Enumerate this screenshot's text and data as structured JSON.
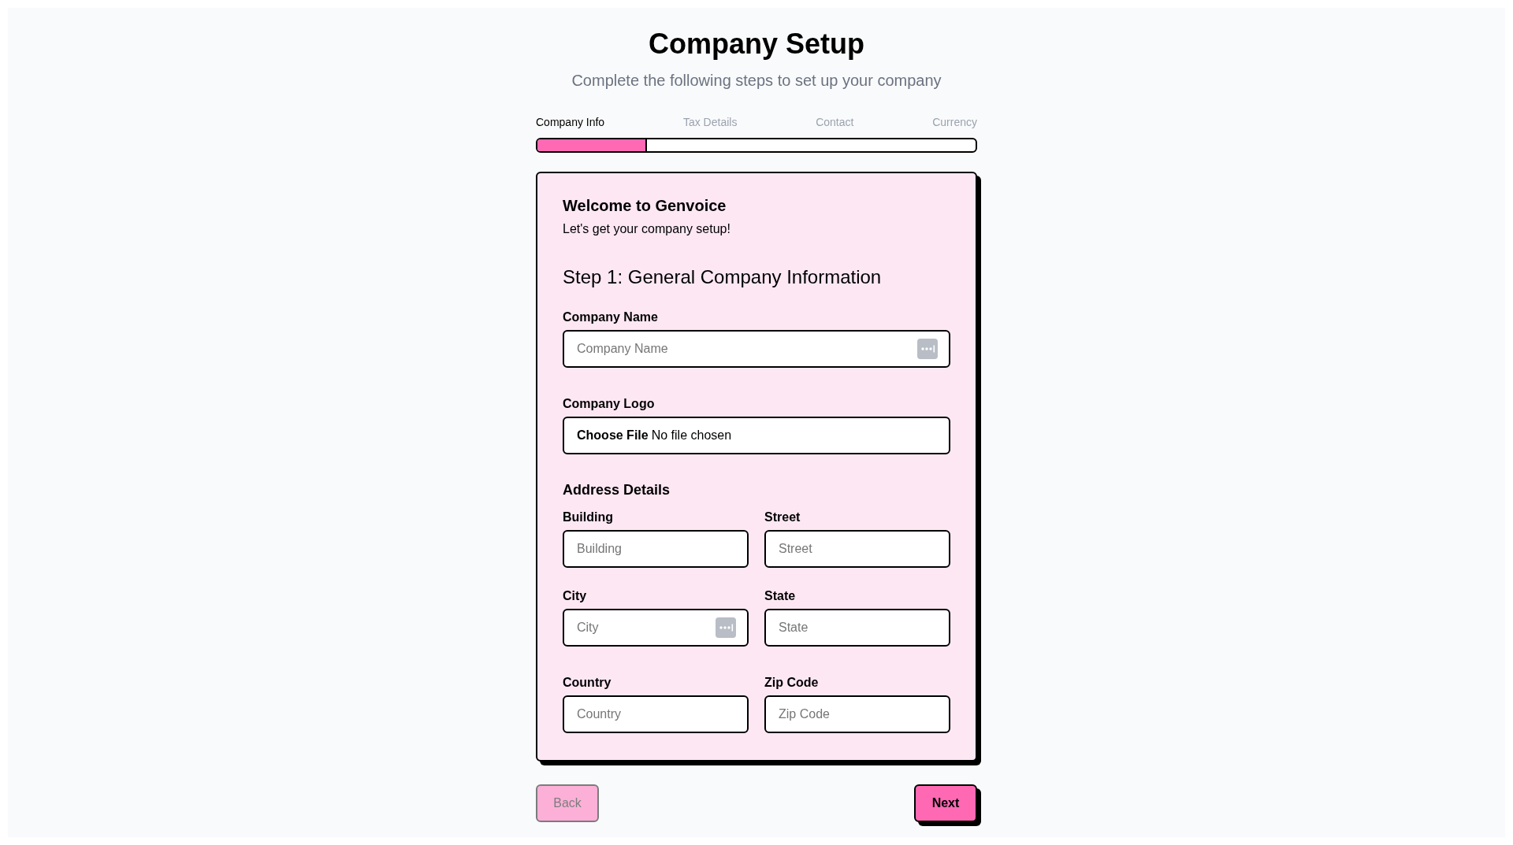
{
  "header": {
    "title": "Company Setup",
    "subtitle": "Complete the following steps to set up your company"
  },
  "steps": [
    {
      "label": "Company Info",
      "selected": true
    },
    {
      "label": "Tax Details",
      "selected": false
    },
    {
      "label": "Contact",
      "selected": false
    },
    {
      "label": "Currency",
      "selected": false
    }
  ],
  "progress": {
    "level": 0.25
  },
  "card": {
    "welcome_title": "Welcome to Genvoice",
    "welcome_text": "Let's get your company setup!",
    "step_title": "Step 1: General Company Information",
    "company_name": {
      "label": "Company Name",
      "placeholder": "Company Name",
      "autofill_icon": true
    },
    "company_logo": {
      "label": "Company Logo",
      "button": "Choose File",
      "status": "No file chosen"
    },
    "address": {
      "title": "Address Details",
      "fields": [
        {
          "label": "Building",
          "placeholder": "Building",
          "autofill_icon": false
        },
        {
          "label": "Street",
          "placeholder": "Street",
          "autofill_icon": false
        },
        {
          "label": "City",
          "placeholder": "City",
          "autofill_icon": true
        },
        {
          "label": "State",
          "placeholder": "State",
          "autofill_icon": false
        },
        {
          "label": "Country",
          "placeholder": "Country",
          "autofill_icon": false
        },
        {
          "label": "Zip Code",
          "placeholder": "Zip Code",
          "autofill_icon": false
        }
      ]
    }
  },
  "buttons": [
    {
      "label": "Back",
      "disabled": true
    },
    {
      "label": "Next",
      "disabled": false
    }
  ]
}
